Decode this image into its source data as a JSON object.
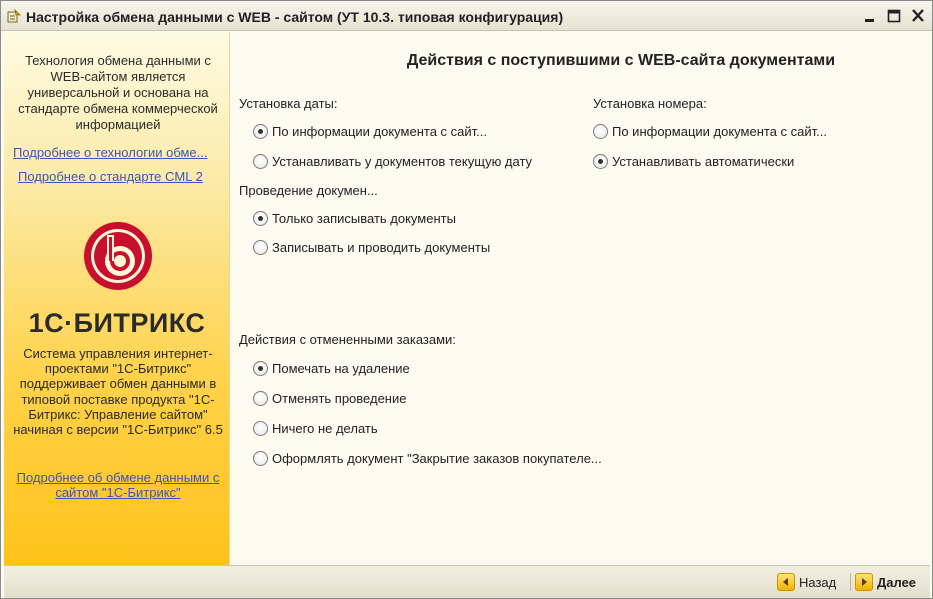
{
  "window": {
    "title": "Настройка обмена данными с WEB - сайтом (УТ 10.3. типовая конфигурация)"
  },
  "sidebar": {
    "intro": "Технология обмена данными с WEB-сайтом является универсальной и основана на стандарте обмена коммерческой информацией",
    "link_technology": "Подробнее о технологии обме...",
    "link_standard": "Подробнее о стандарте CML 2",
    "logo_text": "1С·БИТРИКС",
    "description": "Система управления интернет-проектами \"1С-Битрикс\" поддерживает обмен данными в типовой поставке продукта \"1С-Битрикс: Управление сайтом\" начиная с версии \"1С-Битрикс\" 6.5",
    "link_exchange": "Подробнее об обмене данными с сайтом \"1С-Битрикс\"",
    "brand_red": "#c8102e",
    "gradient_bottom": "#ffc21a"
  },
  "main": {
    "heading": "Действия с поступившими с WEB-сайта документами",
    "date_group": {
      "label": "Установка даты:",
      "options": [
        {
          "label": "По информации документа с сайт...",
          "checked": true
        },
        {
          "label": "Устанавливать у документов текущую дату",
          "checked": false
        }
      ]
    },
    "number_group": {
      "label": "Установка номера:",
      "options": [
        {
          "label": "По информации документа с сайт...",
          "checked": false
        },
        {
          "label": "Устанавливать автоматически",
          "checked": true
        }
      ]
    },
    "posting_group": {
      "label": "Проведение докумен...",
      "options": [
        {
          "label": "Только записывать документы",
          "checked": true
        },
        {
          "label": "Записывать и проводить документы",
          "checked": false
        }
      ]
    },
    "cancel_group": {
      "label": "Действия с отмененными заказами:",
      "options": [
        {
          "label": "Помечать на удаление",
          "checked": true
        },
        {
          "label": "Отменять проведение",
          "checked": false
        },
        {
          "label": "Ничего не делать",
          "checked": false
        },
        {
          "label": "Оформлять документ \"Закрытие заказов покупателе...",
          "checked": false
        }
      ]
    }
  },
  "footer": {
    "back_label": "Назад",
    "next_label": "Далее"
  }
}
